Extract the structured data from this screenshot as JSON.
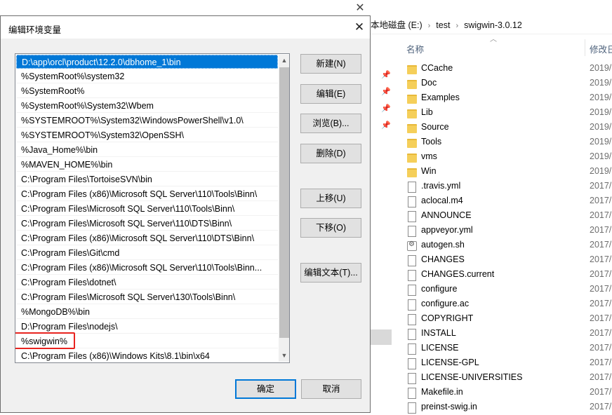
{
  "explorer": {
    "window_close_glyph": "✕",
    "breadcrumb": [
      "本地磁盘 (E:)",
      "test",
      "swigwin-3.0.12"
    ],
    "breadcrumb_separator": "›",
    "columns": {
      "name": "名称",
      "date": "修改日"
    },
    "files": [
      {
        "name": "CCache",
        "date": "2019/",
        "type": "folder"
      },
      {
        "name": "Doc",
        "date": "2019/",
        "type": "folder"
      },
      {
        "name": "Examples",
        "date": "2019/",
        "type": "folder"
      },
      {
        "name": "Lib",
        "date": "2019/",
        "type": "folder"
      },
      {
        "name": "Source",
        "date": "2019/",
        "type": "folder"
      },
      {
        "name": "Tools",
        "date": "2019/",
        "type": "folder"
      },
      {
        "name": "vms",
        "date": "2019/",
        "type": "folder"
      },
      {
        "name": "Win",
        "date": "2019/",
        "type": "folder"
      },
      {
        "name": ".travis.yml",
        "date": "2017/",
        "type": "file"
      },
      {
        "name": "aclocal.m4",
        "date": "2017/",
        "type": "file"
      },
      {
        "name": "ANNOUNCE",
        "date": "2017/",
        "type": "file"
      },
      {
        "name": "appveyor.yml",
        "date": "2017/",
        "type": "file"
      },
      {
        "name": "autogen.sh",
        "date": "2017/",
        "type": "script"
      },
      {
        "name": "CHANGES",
        "date": "2017/",
        "type": "file"
      },
      {
        "name": "CHANGES.current",
        "date": "2017/",
        "type": "file"
      },
      {
        "name": "configure",
        "date": "2017/",
        "type": "file"
      },
      {
        "name": "configure.ac",
        "date": "2017/",
        "type": "file"
      },
      {
        "name": "COPYRIGHT",
        "date": "2017/",
        "type": "file"
      },
      {
        "name": "INSTALL",
        "date": "2017/",
        "type": "file"
      },
      {
        "name": "LICENSE",
        "date": "2017/",
        "type": "file"
      },
      {
        "name": "LICENSE-GPL",
        "date": "2017/",
        "type": "file"
      },
      {
        "name": "LICENSE-UNIVERSITIES",
        "date": "2017/",
        "type": "file"
      },
      {
        "name": "Makefile.in",
        "date": "2017/",
        "type": "file"
      },
      {
        "name": "preinst-swig.in",
        "date": "2017/",
        "type": "file"
      }
    ]
  },
  "dialog": {
    "title": "编辑环境变量",
    "close_glyph": "✕",
    "entries": [
      "D:\\app\\orcl\\product\\12.2.0\\dbhome_1\\bin",
      "%SystemRoot%\\system32",
      "%SystemRoot%",
      "%SystemRoot%\\System32\\Wbem",
      "%SYSTEMROOT%\\System32\\WindowsPowerShell\\v1.0\\",
      "%SYSTEMROOT%\\System32\\OpenSSH\\",
      "%Java_Home%\\bin",
      "%MAVEN_HOME%\\bin",
      "C:\\Program Files\\TortoiseSVN\\bin",
      "C:\\Program Files (x86)\\Microsoft SQL Server\\110\\Tools\\Binn\\",
      "C:\\Program Files\\Microsoft SQL Server\\110\\Tools\\Binn\\",
      "C:\\Program Files\\Microsoft SQL Server\\110\\DTS\\Binn\\",
      "C:\\Program Files (x86)\\Microsoft SQL Server\\110\\DTS\\Binn\\",
      "C:\\Program Files\\Git\\cmd",
      "C:\\Program Files (x86)\\Microsoft SQL Server\\110\\Tools\\Binn...",
      "C:\\Program Files\\dotnet\\",
      "C:\\Program Files\\Microsoft SQL Server\\130\\Tools\\Binn\\",
      "%MongoDB%\\bin",
      "D:\\Program Files\\nodejs\\",
      "%swigwin%",
      "C:\\Program Files (x86)\\Windows Kits\\8.1\\bin\\x64"
    ],
    "selected_index": 0,
    "highlighted_index": 19,
    "scroll_up_glyph": "▲",
    "scroll_down_glyph": "▼",
    "buttons": {
      "new": "新建(N)",
      "edit": "编辑(E)",
      "browse": "浏览(B)...",
      "delete": "删除(D)",
      "move_up": "上移(U)",
      "move_down": "下移(O)",
      "edit_text": "编辑文本(T)...",
      "ok": "确定",
      "cancel": "取消"
    },
    "colors": {
      "selection": "#0078d7",
      "highlight_box": "#e8231f"
    }
  }
}
